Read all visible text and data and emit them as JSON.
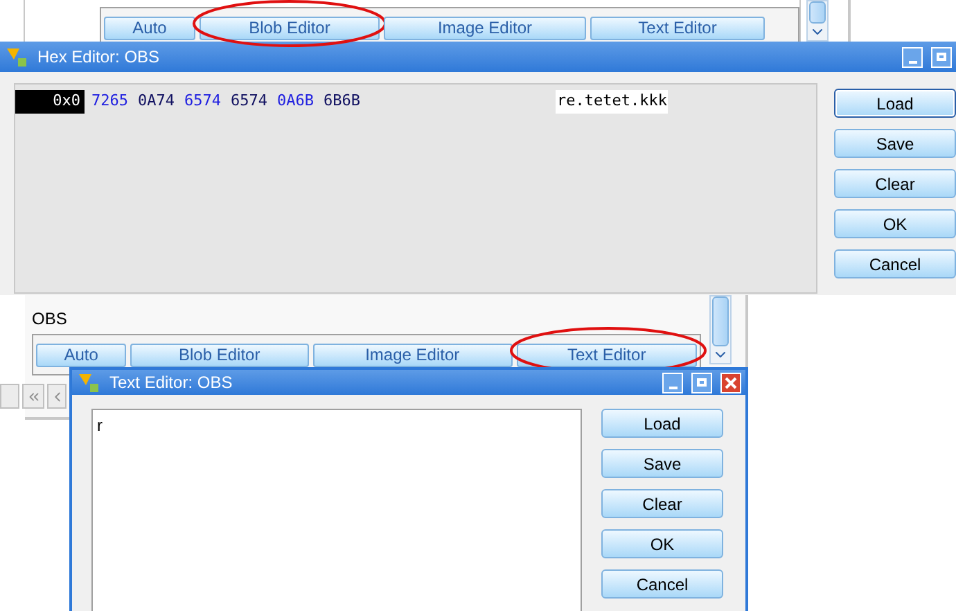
{
  "top_panel": {
    "editor_buttons": [
      {
        "label": "Auto",
        "circled": false
      },
      {
        "label": "Blob Editor",
        "circled": true
      },
      {
        "label": "Image Editor",
        "circled": false
      },
      {
        "label": "Text Editor",
        "circled": false
      }
    ]
  },
  "hex_editor": {
    "title": "Hex Editor: OBS",
    "offset": "0x0",
    "hex_words": [
      {
        "text": "7265",
        "color": "#2020e0"
      },
      {
        "text": "0A74",
        "color": "#101060"
      },
      {
        "text": "6574",
        "color": "#2020e0"
      },
      {
        "text": "6574",
        "color": "#101060"
      },
      {
        "text": "0A6B",
        "color": "#2020e0"
      },
      {
        "text": "6B6B",
        "color": "#101060"
      }
    ],
    "ascii": "re.tetet.kkk",
    "buttons": [
      {
        "label": "Load",
        "focused": true
      },
      {
        "label": "Save",
        "focused": false
      },
      {
        "label": "Clear",
        "focused": false
      },
      {
        "label": "OK",
        "focused": false
      },
      {
        "label": "Cancel",
        "focused": false
      }
    ]
  },
  "bottom_panel": {
    "label": "OBS",
    "editor_buttons": [
      {
        "label": "Auto",
        "circled": false
      },
      {
        "label": "Blob Editor",
        "circled": false
      },
      {
        "label": "Image Editor",
        "circled": false
      },
      {
        "label": "Text Editor",
        "circled": true
      }
    ]
  },
  "text_editor": {
    "title": "Text Editor: OBS",
    "content": "r",
    "buttons": [
      {
        "label": "Load",
        "focused": false
      },
      {
        "label": "Save",
        "focused": false
      },
      {
        "label": "Clear",
        "focused": false
      },
      {
        "label": "OK",
        "focused": false
      },
      {
        "label": "Cancel",
        "focused": false
      }
    ]
  }
}
